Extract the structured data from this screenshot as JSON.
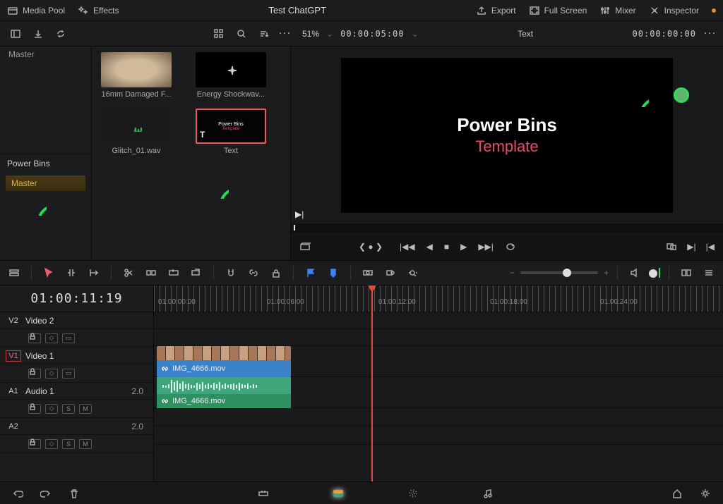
{
  "header": {
    "media_pool": "Media Pool",
    "effects": "Effects",
    "title": "Test ChatGPT",
    "export": "Export",
    "full_screen": "Full Screen",
    "mixer": "Mixer",
    "inspector": "Inspector"
  },
  "panelbar": {
    "zoom": "51%",
    "tc": "00:00:05:00",
    "clip": "Text",
    "dur": "00:00:00:00"
  },
  "sidebar": {
    "master": "Master",
    "power_bins_label": "Power Bins",
    "power_master": "Master"
  },
  "pool": {
    "items": [
      {
        "label": "16mm Damaged F..."
      },
      {
        "label": "Energy Shockwav..."
      },
      {
        "label": "Glitch_01.wav"
      },
      {
        "label": "Text"
      }
    ],
    "text_thumb": {
      "line1": "Power Bins",
      "line2": "Template",
      "badge": "T"
    }
  },
  "viewer": {
    "line1": "Power Bins",
    "line2": "Template"
  },
  "timeline": {
    "tc": "01:00:11:19",
    "ruler": [
      "01:00:00:00",
      "01:00:06:00",
      "01:00:12:00",
      "01:00:18:00",
      "01:00:24:00"
    ],
    "tracks": {
      "v2": "Video 2",
      "v1": "Video 1",
      "a1": "Audio 1",
      "a2": "",
      "a1_level": "2.0",
      "a2_level": "2.0",
      "v2_tag": "V2",
      "v1_tag": "V1",
      "a1_tag": "A1",
      "a2_tag": "A2",
      "s": "S",
      "m": "M"
    },
    "clips": {
      "video": "IMG_4666.mov",
      "audio": "IMG_4666.mov"
    }
  }
}
